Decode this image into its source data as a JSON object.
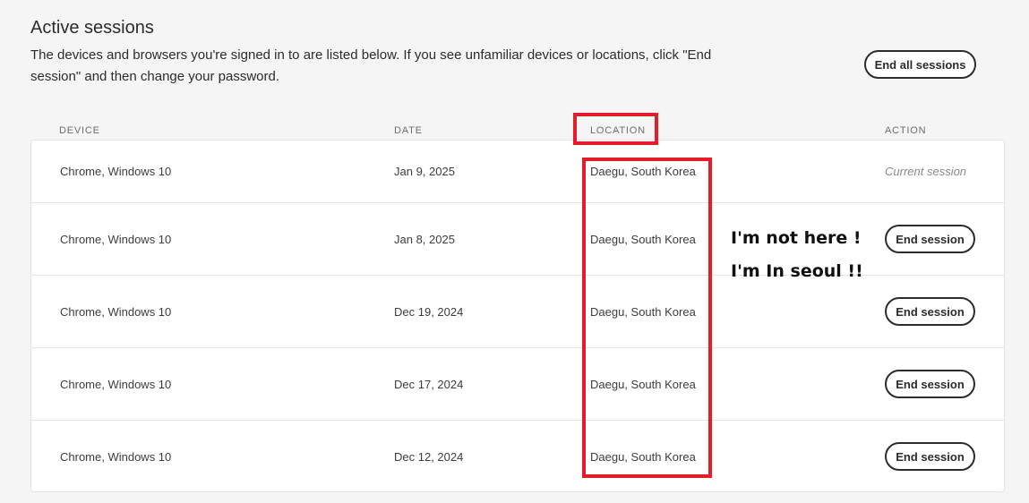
{
  "header": {
    "title": "Active sessions",
    "description": "The devices and browsers you're signed in to are listed below. If you see unfamiliar devices or locations, click \"End session\" and then change your password.",
    "end_all_label": "End all sessions"
  },
  "table": {
    "columns": {
      "device": "DEVICE",
      "date": "DATE",
      "location": "LOCATION",
      "action": "ACTION"
    },
    "rows": [
      {
        "device": "Chrome, Windows 10",
        "date": "Jan 9, 2025",
        "location": "Daegu, South Korea",
        "action": "Current session"
      },
      {
        "device": "Chrome, Windows 10",
        "date": "Jan 8, 2025",
        "location": "Daegu, South Korea",
        "action": "End session"
      },
      {
        "device": "Chrome, Windows 10",
        "date": "Dec 19, 2024",
        "location": "Daegu, South Korea",
        "action": "End session"
      },
      {
        "device": "Chrome, Windows 10",
        "date": "Dec 17, 2024",
        "location": "Daegu, South Korea",
        "action": "End session"
      },
      {
        "device": "Chrome, Windows 10",
        "date": "Dec 12, 2024",
        "location": "Daegu, South Korea",
        "action": "End session"
      }
    ]
  },
  "annotation": {
    "line1": "I'm not here !",
    "line2": "I'm In seoul !!",
    "highlight_color": "#e11e2a"
  }
}
